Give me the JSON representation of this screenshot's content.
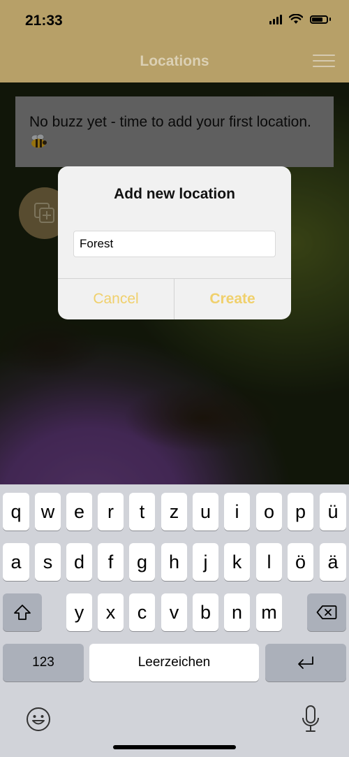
{
  "status_bar": {
    "time": "21:33"
  },
  "nav": {
    "title": "Locations"
  },
  "banner": {
    "text": "No buzz yet - time to add your first location."
  },
  "dialog": {
    "title": "Add new location",
    "input_value": "Forest",
    "cancel_label": "Cancel",
    "create_label": "Create"
  },
  "keyboard": {
    "row1": [
      "q",
      "w",
      "e",
      "r",
      "t",
      "z",
      "u",
      "i",
      "o",
      "p",
      "ü"
    ],
    "row2": [
      "a",
      "s",
      "d",
      "f",
      "g",
      "h",
      "j",
      "k",
      "l",
      "ö",
      "ä"
    ],
    "row3": [
      "y",
      "x",
      "c",
      "v",
      "b",
      "n",
      "m"
    ],
    "numbers_label": "123",
    "space_label": "Leerzeichen"
  },
  "colors": {
    "accent": "#b7a068",
    "button_text": "#f0d06c",
    "keyboard_bg": "#d1d3d9"
  }
}
